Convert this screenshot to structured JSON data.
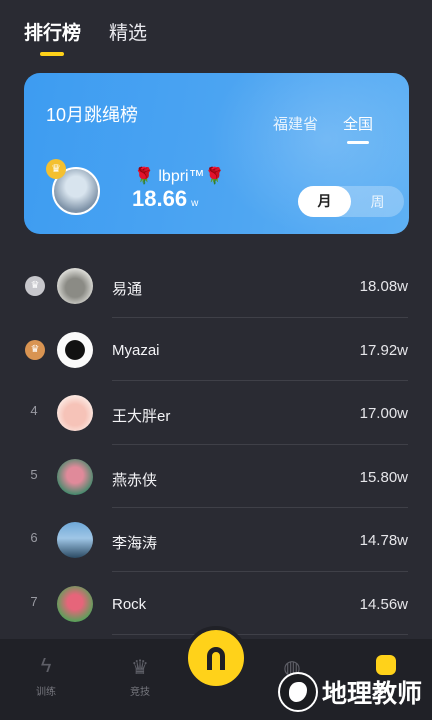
{
  "top_tabs": [
    {
      "label": "排行榜",
      "active": true
    },
    {
      "label": "精选",
      "active": false
    }
  ],
  "banner": {
    "title": "10月跳绳榜",
    "scope_tabs": [
      {
        "label": "福建省",
        "active": false
      },
      {
        "label": "全国",
        "active": true
      }
    ],
    "champion": {
      "name": "🌹 lbpri™🌹",
      "score": "18.66",
      "unit": "w"
    },
    "period_toggle": [
      {
        "label": "月",
        "active": true
      },
      {
        "label": "周",
        "active": false
      }
    ]
  },
  "ranking": [
    {
      "rank": "",
      "medal": "silver",
      "name": "易通",
      "score": "18.08w"
    },
    {
      "rank": "",
      "medal": "bronze",
      "name": "Myazai",
      "score": "17.92w"
    },
    {
      "rank": "4",
      "medal": "",
      "name": "王大胖er",
      "score": "17.00w"
    },
    {
      "rank": "5",
      "medal": "",
      "name": "燕赤侠",
      "score": "15.80w"
    },
    {
      "rank": "6",
      "medal": "",
      "name": "李海涛",
      "score": "14.78w"
    },
    {
      "rank": "7",
      "medal": "",
      "name": "Rock",
      "score": "14.56w"
    }
  ],
  "bottom_nav": [
    {
      "label": "训练",
      "icon": "lightning-icon"
    },
    {
      "label": "竞技",
      "icon": "crown-icon"
    },
    {
      "label": "",
      "icon": "planet-icon"
    },
    {
      "label": "",
      "icon": "mine-face-icon"
    }
  ],
  "watermark": "地理教师",
  "colors": {
    "accent": "#ffd21a",
    "banner": "#3d9cf1",
    "background": "#2a2b33",
    "nav": "#202127"
  }
}
